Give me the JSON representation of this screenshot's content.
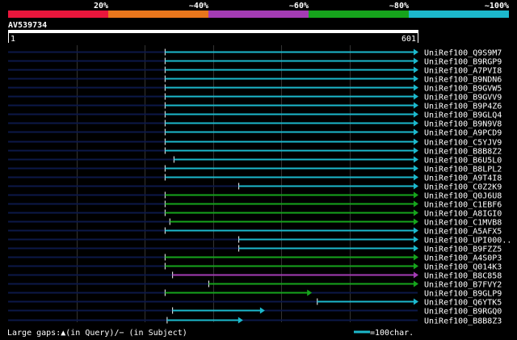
{
  "query": {
    "name": "AV539734",
    "start": "1",
    "end": "601",
    "length": 601
  },
  "identity_legend": [
    {
      "label": "20%",
      "color": "#e8163c"
    },
    {
      "label": "~40%",
      "color": "#e8761c"
    },
    {
      "label": "~60%",
      "color": "#a43cb4"
    },
    {
      "label": "~80%",
      "color": "#16a41c"
    },
    {
      "label": "~100%",
      "color": "#1cb8cc"
    }
  ],
  "hits": [
    {
      "name": "UniRef100_Q9S9M7",
      "start": 231,
      "end": 601,
      "color": "#1cb8cc",
      "arrow": true
    },
    {
      "name": "UniRef100_B9RGP9",
      "start": 231,
      "end": 601,
      "color": "#1cb8cc",
      "arrow": true
    },
    {
      "name": "UniRef100_A7PVI8",
      "start": 231,
      "end": 601,
      "color": "#1cb8cc",
      "arrow": true
    },
    {
      "name": "UniRef100_B9NDN6",
      "start": 231,
      "end": 601,
      "color": "#1cb8cc",
      "arrow": true
    },
    {
      "name": "UniRef100_B9GVW5",
      "start": 231,
      "end": 601,
      "color": "#1cb8cc",
      "arrow": true
    },
    {
      "name": "UniRef100_B9GVV9",
      "start": 231,
      "end": 601,
      "color": "#1cb8cc",
      "arrow": true
    },
    {
      "name": "UniRef100_B9P4Z6",
      "start": 231,
      "end": 601,
      "color": "#1cb8cc",
      "arrow": true
    },
    {
      "name": "UniRef100_B9GLQ4",
      "start": 231,
      "end": 601,
      "color": "#1cb8cc",
      "arrow": true
    },
    {
      "name": "UniRef100_B9N9V8",
      "start": 231,
      "end": 601,
      "color": "#1cb8cc",
      "arrow": true
    },
    {
      "name": "UniRef100_A9PCD9",
      "start": 231,
      "end": 601,
      "color": "#1cb8cc",
      "arrow": true
    },
    {
      "name": "UniRef100_C5YJV9",
      "start": 231,
      "end": 601,
      "color": "#1cb8cc",
      "arrow": true
    },
    {
      "name": "UniRef100_B8B8Z2",
      "start": 231,
      "end": 601,
      "color": "#1cb8cc",
      "arrow": true
    },
    {
      "name": "UniRef100_B6U5L0",
      "start": 244,
      "end": 601,
      "color": "#1cb8cc",
      "arrow": true
    },
    {
      "name": "UniRef100_B8LPL2",
      "start": 231,
      "end": 601,
      "color": "#1cb8cc",
      "arrow": true
    },
    {
      "name": "UniRef100_A9T4I8",
      "start": 231,
      "end": 601,
      "color": "#1cb8cc",
      "arrow": true
    },
    {
      "name": "UniRef100_C0Z2K9",
      "start": 339,
      "end": 601,
      "color": "#1cb8cc",
      "arrow": true
    },
    {
      "name": "UniRef100_Q0J6U8",
      "start": 231,
      "end": 601,
      "color": "#16a41c",
      "arrow": true
    },
    {
      "name": "UniRef100_C1EBF6",
      "start": 231,
      "end": 601,
      "color": "#16a41c",
      "arrow": true
    },
    {
      "name": "UniRef100_A8IGI0",
      "start": 231,
      "end": 601,
      "color": "#16a41c",
      "arrow": true
    },
    {
      "name": "UniRef100_C1MVB8",
      "start": 238,
      "end": 601,
      "color": "#16a41c",
      "arrow": true
    },
    {
      "name": "UniRef100_A5AFX5",
      "start": 231,
      "end": 601,
      "color": "#1cb8cc",
      "arrow": true
    },
    {
      "name": "UniRef100_UPI000..",
      "start": 339,
      "end": 601,
      "color": "#1cb8cc",
      "arrow": true
    },
    {
      "name": "UniRef100_B9FZZ5",
      "start": 339,
      "end": 601,
      "color": "#1cb8cc",
      "arrow": true
    },
    {
      "name": "UniRef100_A4S0P3",
      "start": 231,
      "end": 601,
      "color": "#16a41c",
      "arrow": true
    },
    {
      "name": "UniRef100_Q014K3",
      "start": 231,
      "end": 601,
      "color": "#16a41c",
      "arrow": true
    },
    {
      "name": "UniRef100_B8C858",
      "start": 242,
      "end": 601,
      "color": "#a43cb4",
      "arrow": true
    },
    {
      "name": "UniRef100_B7FVY2",
      "start": 295,
      "end": 601,
      "color": "#16a41c",
      "arrow": true
    },
    {
      "name": "UniRef100_B9GLP9",
      "start": 231,
      "end": 445,
      "color": "#16a41c",
      "arrow": true
    },
    {
      "name": "UniRef100_Q6YTK5",
      "start": 454,
      "end": 601,
      "color": "#1cb8cc",
      "arrow": true
    },
    {
      "name": "UniRef100_B9RGQ0",
      "start": 242,
      "end": 376,
      "color": "#1cb8cc",
      "arrow": true
    },
    {
      "name": "UniRef100_B8B8Z3",
      "start": 234,
      "end": 344,
      "color": "#1cb8cc",
      "arrow": true
    }
  ],
  "footer": {
    "gaps_text": "Large gaps:▲(in Query)/− (in Subject)",
    "scale_text": "=100char."
  }
}
